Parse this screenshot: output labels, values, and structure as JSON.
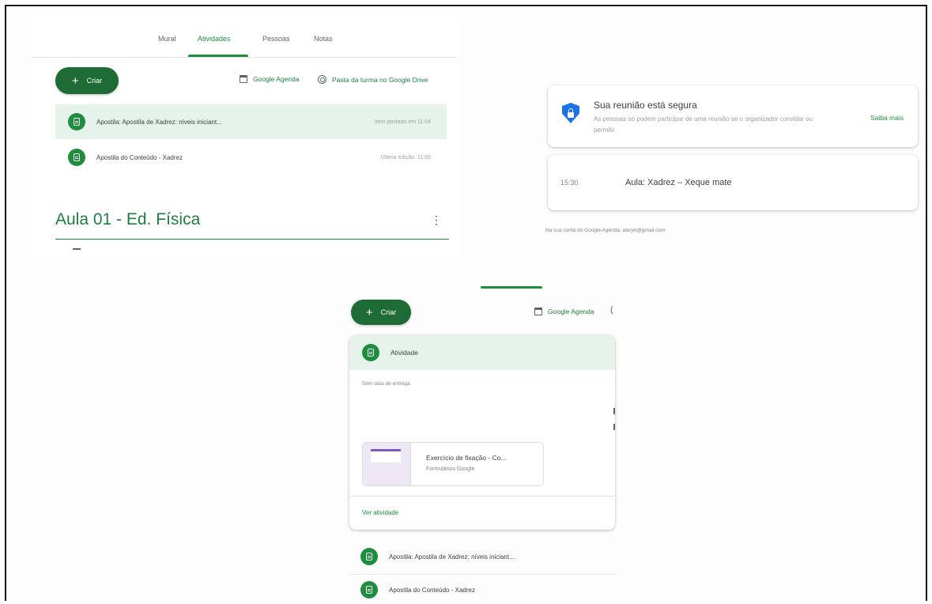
{
  "classroom": {
    "tabs": [
      "Mural",
      "Atividades",
      "Pessoas",
      "Notas"
    ],
    "active_tab_index": 1,
    "create_label": "Criar",
    "calendar_link": "Google Agenda",
    "drive_link": "Pasta da turma no Google Drive",
    "items": [
      {
        "title": "Apostila: Apostila de Xadrez: níveis iniciant...",
        "meta": "Item postado em 11:04",
        "highlighted": true
      },
      {
        "title": "Apostila do Conteúdo - Xadrez",
        "meta": "Última edição: 11:00",
        "highlighted": false
      }
    ],
    "section_title": "Aula 01 - Ed. Física",
    "section_menu_glyph": "⋮"
  },
  "meet": {
    "security_title": "Sua reunião está segura",
    "security_body": "As pessoas só podem participar de uma reunião se o organizador convidar ou permitir",
    "learn_more": "Saiba mais",
    "event_time": "15:30",
    "event_title": "Aula: Xadrez – Xeque mate",
    "account_note": "Na sua conta do Google Agenda: aleryn@gmail.com"
  },
  "activity_view": {
    "create_label": "Criar",
    "calendar_link": "Google Agenda",
    "card_title": "Atividade",
    "due_text": "Sem data de entrega",
    "attachment_title": "Exercício de fixação - Co...",
    "attachment_type": "Formulários Google",
    "view_link": "Ver atividade",
    "items": [
      "Apostila: Apostila de Xadrez: níveis iniciant...",
      "Apostila do Conteúdo - Xadrez"
    ]
  },
  "colors": {
    "primary_green": "#1e8e3e",
    "dark_green": "#1e6b35",
    "highlight": "#e6f3ea",
    "shield_blue": "#1a73e8"
  },
  "icons": [
    "calendar-icon",
    "drive-folder-icon",
    "assignment-icon",
    "shield-lock-icon",
    "kebab-menu-icon",
    "plus-icon"
  ]
}
